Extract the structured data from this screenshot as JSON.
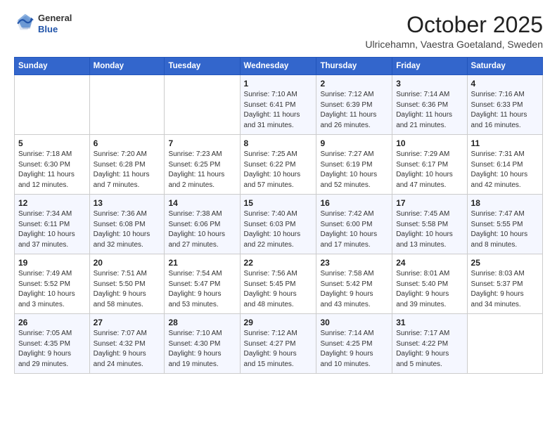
{
  "header": {
    "logo_line1": "General",
    "logo_line2": "Blue",
    "month": "October 2025",
    "location": "Ulricehamn, Vaestra Goetaland, Sweden"
  },
  "weekdays": [
    "Sunday",
    "Monday",
    "Tuesday",
    "Wednesday",
    "Thursday",
    "Friday",
    "Saturday"
  ],
  "weeks": [
    [
      {
        "day": "",
        "info": ""
      },
      {
        "day": "",
        "info": ""
      },
      {
        "day": "",
        "info": ""
      },
      {
        "day": "1",
        "info": "Sunrise: 7:10 AM\nSunset: 6:41 PM\nDaylight: 11 hours\nand 31 minutes."
      },
      {
        "day": "2",
        "info": "Sunrise: 7:12 AM\nSunset: 6:39 PM\nDaylight: 11 hours\nand 26 minutes."
      },
      {
        "day": "3",
        "info": "Sunrise: 7:14 AM\nSunset: 6:36 PM\nDaylight: 11 hours\nand 21 minutes."
      },
      {
        "day": "4",
        "info": "Sunrise: 7:16 AM\nSunset: 6:33 PM\nDaylight: 11 hours\nand 16 minutes."
      }
    ],
    [
      {
        "day": "5",
        "info": "Sunrise: 7:18 AM\nSunset: 6:30 PM\nDaylight: 11 hours\nand 12 minutes."
      },
      {
        "day": "6",
        "info": "Sunrise: 7:20 AM\nSunset: 6:28 PM\nDaylight: 11 hours\nand 7 minutes."
      },
      {
        "day": "7",
        "info": "Sunrise: 7:23 AM\nSunset: 6:25 PM\nDaylight: 11 hours\nand 2 minutes."
      },
      {
        "day": "8",
        "info": "Sunrise: 7:25 AM\nSunset: 6:22 PM\nDaylight: 10 hours\nand 57 minutes."
      },
      {
        "day": "9",
        "info": "Sunrise: 7:27 AM\nSunset: 6:19 PM\nDaylight: 10 hours\nand 52 minutes."
      },
      {
        "day": "10",
        "info": "Sunrise: 7:29 AM\nSunset: 6:17 PM\nDaylight: 10 hours\nand 47 minutes."
      },
      {
        "day": "11",
        "info": "Sunrise: 7:31 AM\nSunset: 6:14 PM\nDaylight: 10 hours\nand 42 minutes."
      }
    ],
    [
      {
        "day": "12",
        "info": "Sunrise: 7:34 AM\nSunset: 6:11 PM\nDaylight: 10 hours\nand 37 minutes."
      },
      {
        "day": "13",
        "info": "Sunrise: 7:36 AM\nSunset: 6:08 PM\nDaylight: 10 hours\nand 32 minutes."
      },
      {
        "day": "14",
        "info": "Sunrise: 7:38 AM\nSunset: 6:06 PM\nDaylight: 10 hours\nand 27 minutes."
      },
      {
        "day": "15",
        "info": "Sunrise: 7:40 AM\nSunset: 6:03 PM\nDaylight: 10 hours\nand 22 minutes."
      },
      {
        "day": "16",
        "info": "Sunrise: 7:42 AM\nSunset: 6:00 PM\nDaylight: 10 hours\nand 17 minutes."
      },
      {
        "day": "17",
        "info": "Sunrise: 7:45 AM\nSunset: 5:58 PM\nDaylight: 10 hours\nand 13 minutes."
      },
      {
        "day": "18",
        "info": "Sunrise: 7:47 AM\nSunset: 5:55 PM\nDaylight: 10 hours\nand 8 minutes."
      }
    ],
    [
      {
        "day": "19",
        "info": "Sunrise: 7:49 AM\nSunset: 5:52 PM\nDaylight: 10 hours\nand 3 minutes."
      },
      {
        "day": "20",
        "info": "Sunrise: 7:51 AM\nSunset: 5:50 PM\nDaylight: 9 hours\nand 58 minutes."
      },
      {
        "day": "21",
        "info": "Sunrise: 7:54 AM\nSunset: 5:47 PM\nDaylight: 9 hours\nand 53 minutes."
      },
      {
        "day": "22",
        "info": "Sunrise: 7:56 AM\nSunset: 5:45 PM\nDaylight: 9 hours\nand 48 minutes."
      },
      {
        "day": "23",
        "info": "Sunrise: 7:58 AM\nSunset: 5:42 PM\nDaylight: 9 hours\nand 43 minutes."
      },
      {
        "day": "24",
        "info": "Sunrise: 8:01 AM\nSunset: 5:40 PM\nDaylight: 9 hours\nand 39 minutes."
      },
      {
        "day": "25",
        "info": "Sunrise: 8:03 AM\nSunset: 5:37 PM\nDaylight: 9 hours\nand 34 minutes."
      }
    ],
    [
      {
        "day": "26",
        "info": "Sunrise: 7:05 AM\nSunset: 4:35 PM\nDaylight: 9 hours\nand 29 minutes."
      },
      {
        "day": "27",
        "info": "Sunrise: 7:07 AM\nSunset: 4:32 PM\nDaylight: 9 hours\nand 24 minutes."
      },
      {
        "day": "28",
        "info": "Sunrise: 7:10 AM\nSunset: 4:30 PM\nDaylight: 9 hours\nand 19 minutes."
      },
      {
        "day": "29",
        "info": "Sunrise: 7:12 AM\nSunset: 4:27 PM\nDaylight: 9 hours\nand 15 minutes."
      },
      {
        "day": "30",
        "info": "Sunrise: 7:14 AM\nSunset: 4:25 PM\nDaylight: 9 hours\nand 10 minutes."
      },
      {
        "day": "31",
        "info": "Sunrise: 7:17 AM\nSunset: 4:22 PM\nDaylight: 9 hours\nand 5 minutes."
      },
      {
        "day": "",
        "info": ""
      }
    ]
  ]
}
